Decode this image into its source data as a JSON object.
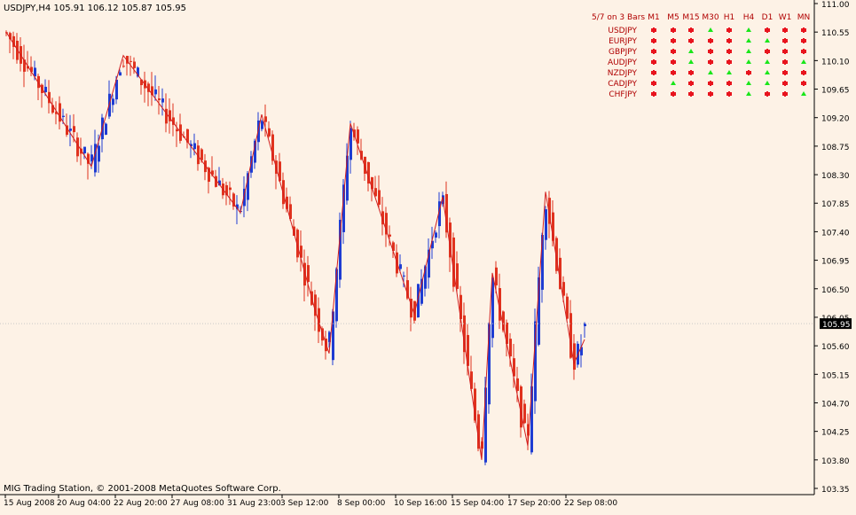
{
  "header": {
    "symbol_info": "USDJPY,H4  105.91 106.12 105.87 105.95"
  },
  "footer": {
    "copyright": "MIG Trading Station, © 2001-2008 MetaQuotes Software Corp."
  },
  "signal_panel": {
    "title": "5/7 on 3 Bars",
    "timeframes": [
      "M1",
      "M5",
      "M15",
      "M30",
      "H1",
      "H4",
      "D1",
      "W1",
      "MN"
    ],
    "rows": [
      {
        "pair": "USDJPY",
        "states": [
          "down",
          "down",
          "down",
          "up",
          "down",
          "up",
          "down",
          "down",
          "down"
        ]
      },
      {
        "pair": "EURJPY",
        "states": [
          "down",
          "down",
          "down",
          "down",
          "down",
          "up",
          "up",
          "down",
          "down"
        ]
      },
      {
        "pair": "GBPJPY",
        "states": [
          "down",
          "down",
          "up",
          "down",
          "down",
          "up",
          "down",
          "down",
          "down"
        ]
      },
      {
        "pair": "AUDJPY",
        "states": [
          "down",
          "down",
          "up",
          "down",
          "down",
          "up",
          "up",
          "down",
          "up"
        ]
      },
      {
        "pair": "NZDJPY",
        "states": [
          "down",
          "down",
          "down",
          "up",
          "up",
          "down",
          "up",
          "down",
          "down"
        ]
      },
      {
        "pair": "CADJPY",
        "states": [
          "down",
          "up",
          "down",
          "down",
          "down",
          "up",
          "up",
          "down",
          "down"
        ]
      },
      {
        "pair": "CHFJPY",
        "states": [
          "down",
          "down",
          "down",
          "down",
          "down",
          "up",
          "down",
          "down",
          "up"
        ]
      }
    ],
    "colors": {
      "down": "#e8141e",
      "up": "#19e619",
      "label": "#b00000"
    }
  },
  "colors": {
    "background": "#fdf2e6",
    "bull": "#1e3cd2",
    "bear": "#e0321e",
    "zigzag": "#d21e1e",
    "axis": "#000000",
    "price_marker_bg": "#000000",
    "price_marker_text": "#ffffff"
  },
  "chart_data": {
    "type": "candlestick",
    "symbol": "USDJPY",
    "timeframe": "H4",
    "current_price": 105.95,
    "ohlc_last": {
      "open": 105.91,
      "high": 106.12,
      "low": 105.87,
      "close": 105.95
    },
    "y_ticks": [
      111.0,
      110.55,
      110.1,
      109.65,
      109.2,
      108.75,
      108.3,
      107.85,
      107.4,
      106.95,
      106.5,
      106.05,
      105.6,
      105.15,
      104.7,
      104.25,
      103.8,
      103.35
    ],
    "ylim": [
      103.35,
      111.0
    ],
    "x_ticks": [
      "15 Aug 2008",
      "20 Aug 04:00",
      "22 Aug 20:00",
      "27 Aug 08:00",
      "31 Aug 23:00",
      "3 Sep 12:00",
      "8 Sep 00:00",
      "10 Sep 16:00",
      "15 Sep 04:00",
      "17 Sep 20:00",
      "22 Sep 08:00"
    ],
    "x_tick_bars": [
      0,
      15,
      31,
      47,
      63,
      78,
      94,
      110,
      126,
      142,
      158
    ],
    "bar_count": 175,
    "zigzag": [
      {
        "bar": 0,
        "price": 110.55
      },
      {
        "bar": 24,
        "price": 108.43
      },
      {
        "bar": 33,
        "price": 110.18
      },
      {
        "bar": 66,
        "price": 107.7
      },
      {
        "bar": 72,
        "price": 109.25
      },
      {
        "bar": 87,
        "price": 106.17
      },
      {
        "bar": 91,
        "price": 105.48
      },
      {
        "bar": 97,
        "price": 109.11
      },
      {
        "bar": 115,
        "price": 106.1
      },
      {
        "bar": 123,
        "price": 107.95
      },
      {
        "bar": 134,
        "price": 103.8
      },
      {
        "bar": 137,
        "price": 106.75
      },
      {
        "bar": 147,
        "price": 104.02
      },
      {
        "bar": 152,
        "price": 108.03
      },
      {
        "bar": 160,
        "price": 105.32
      },
      {
        "bar": 163,
        "price": 105.7
      }
    ],
    "grid": false
  }
}
